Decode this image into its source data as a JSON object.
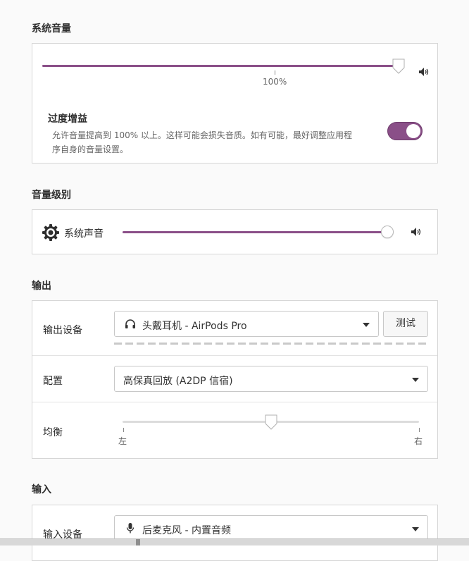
{
  "system_volume": {
    "title": "系统音量",
    "volume_level": 1.0,
    "value_label": "100%",
    "overamplify": {
      "title": "过度增益",
      "description_line1": "允许音量提高到 100% 以上。这样可能会损失音质。如有可能，最好调整应用程",
      "description_line2": "序自身的音量设置。",
      "enabled": true
    }
  },
  "volume_levels": {
    "title": "音量级别",
    "items": [
      {
        "label": "系统声音",
        "icon": "gear-icon",
        "level": 0.99
      }
    ]
  },
  "output": {
    "title": "输出",
    "device_label": "输出设备",
    "device_value": "头戴耳机 - AirPods Pro",
    "test_button": "测试",
    "profile_label": "配置",
    "profile_value": "高保真回放 (A2DP 信宿)",
    "balance_label": "均衡",
    "balance_left": "左",
    "balance_right": "右",
    "balance_value": 0.5
  },
  "input": {
    "title": "输入",
    "device_label": "输入设备",
    "device_value": "后麦克风 - 内置音频"
  },
  "colors": {
    "accent": "#8a4f88",
    "card_bg": "#ffffff",
    "page_bg": "#fafafa"
  }
}
